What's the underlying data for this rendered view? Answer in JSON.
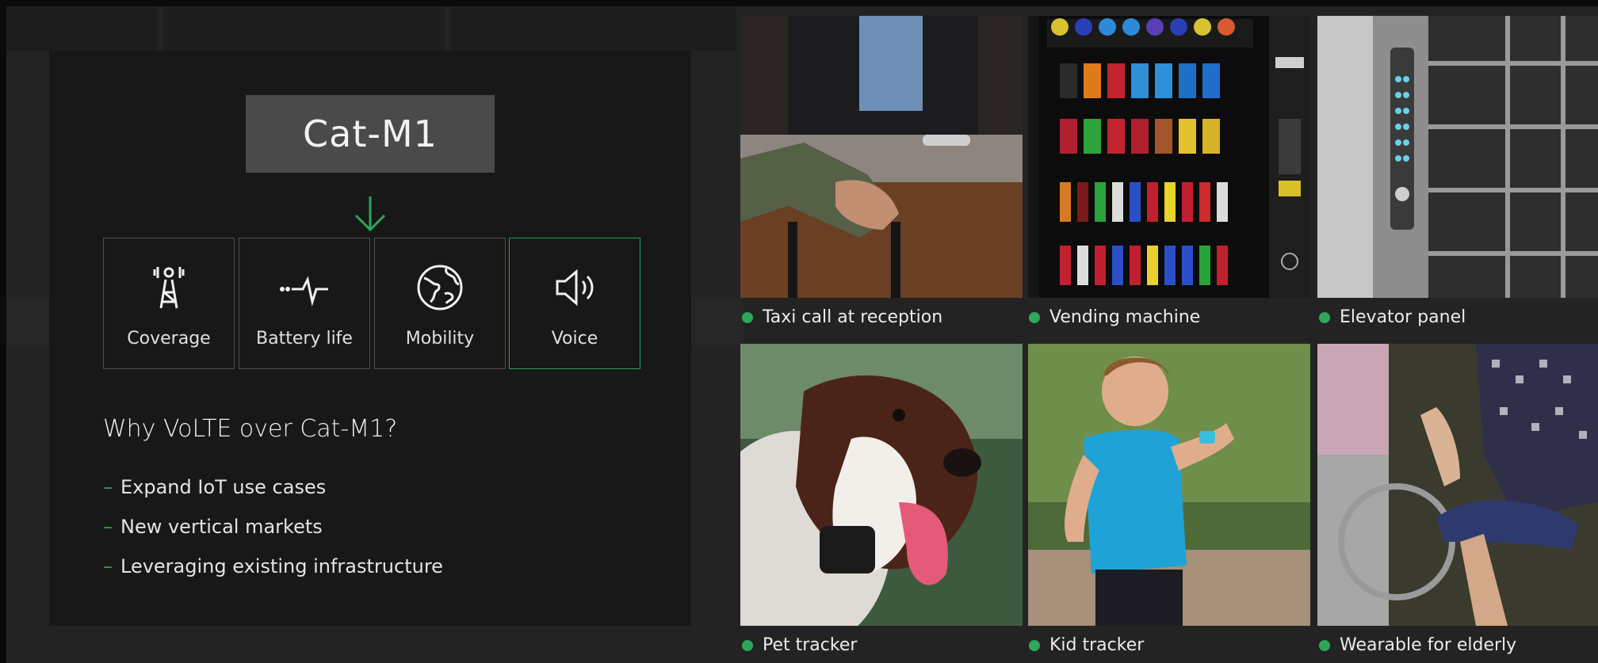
{
  "left_panel": {
    "title": "Cat-M1",
    "features": [
      {
        "label": "Coverage",
        "icon": "coverage-tower-icon"
      },
      {
        "label": "Battery life",
        "icon": "battery-pulse-icon"
      },
      {
        "label": "Mobility",
        "icon": "globe-icon"
      },
      {
        "label": "Voice",
        "icon": "speaker-icon"
      }
    ],
    "active_feature": "Voice",
    "question": "Why VoLTE over Cat-M1?",
    "bullet_marker": "–",
    "bullets": [
      "Expand IoT use cases",
      "New vertical markets",
      "Leveraging existing infrastructure"
    ]
  },
  "use_cases": [
    {
      "caption": "Taxi call at reception"
    },
    {
      "caption": "Vending machine"
    },
    {
      "caption": "Elevator panel"
    },
    {
      "caption": "Pet tracker"
    },
    {
      "caption": "Kid tracker"
    },
    {
      "caption": "Wearable for elderly"
    }
  ],
  "colors": {
    "accent_green": "#2fa65a",
    "card_bg": "#181818",
    "title_box_bg": "#4a4a4a",
    "page_bg": "#232323"
  }
}
